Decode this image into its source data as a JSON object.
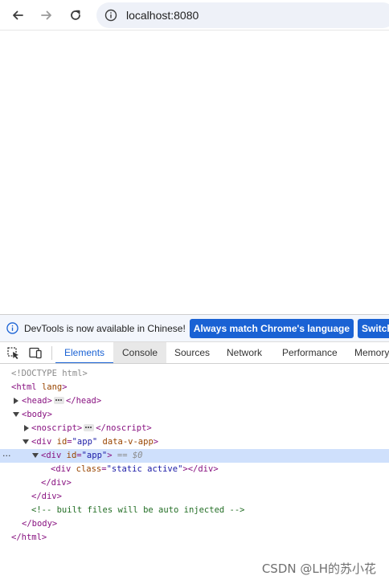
{
  "browser": {
    "address": "localhost:8080",
    "icons": [
      "back-arrow-icon",
      "forward-arrow-icon",
      "reload-icon",
      "site-info-icon"
    ]
  },
  "devtools": {
    "infobar": {
      "message": "DevTools is now available in Chinese!",
      "primary_button": "Always match Chrome's language",
      "secondary_button": "Switch Dev"
    },
    "tabs": [
      "Elements",
      "Console",
      "Sources",
      "Network",
      "Performance",
      "Memory"
    ],
    "active_tab": "Elements",
    "accent_color": "#1a62d4",
    "dom": {
      "doctype": "<!DOCTYPE html>",
      "html_open": "<html",
      "html_attr": "lang",
      "html_close_bracket": ">",
      "head_open": "<head>",
      "head_close": "</head>",
      "body_open": "<body>",
      "noscript_open": "<noscript>",
      "noscript_close": "</noscript>",
      "div_open": "<div",
      "id_attr": "id",
      "app_value": "\"app\"",
      "data_attr": "data-v-app",
      "close_bracket": ">",
      "equals": "=",
      "selected_marker": "== $0",
      "inner_class_attr": "class",
      "inner_class_value": "\"static active\"",
      "div_close": "</div>",
      "comment": "<!-- built files will be auto injected -->",
      "body_close": "</body>",
      "html_close": "</html>",
      "row_menu": "···"
    }
  },
  "watermark": "CSDN @LH的苏小花"
}
